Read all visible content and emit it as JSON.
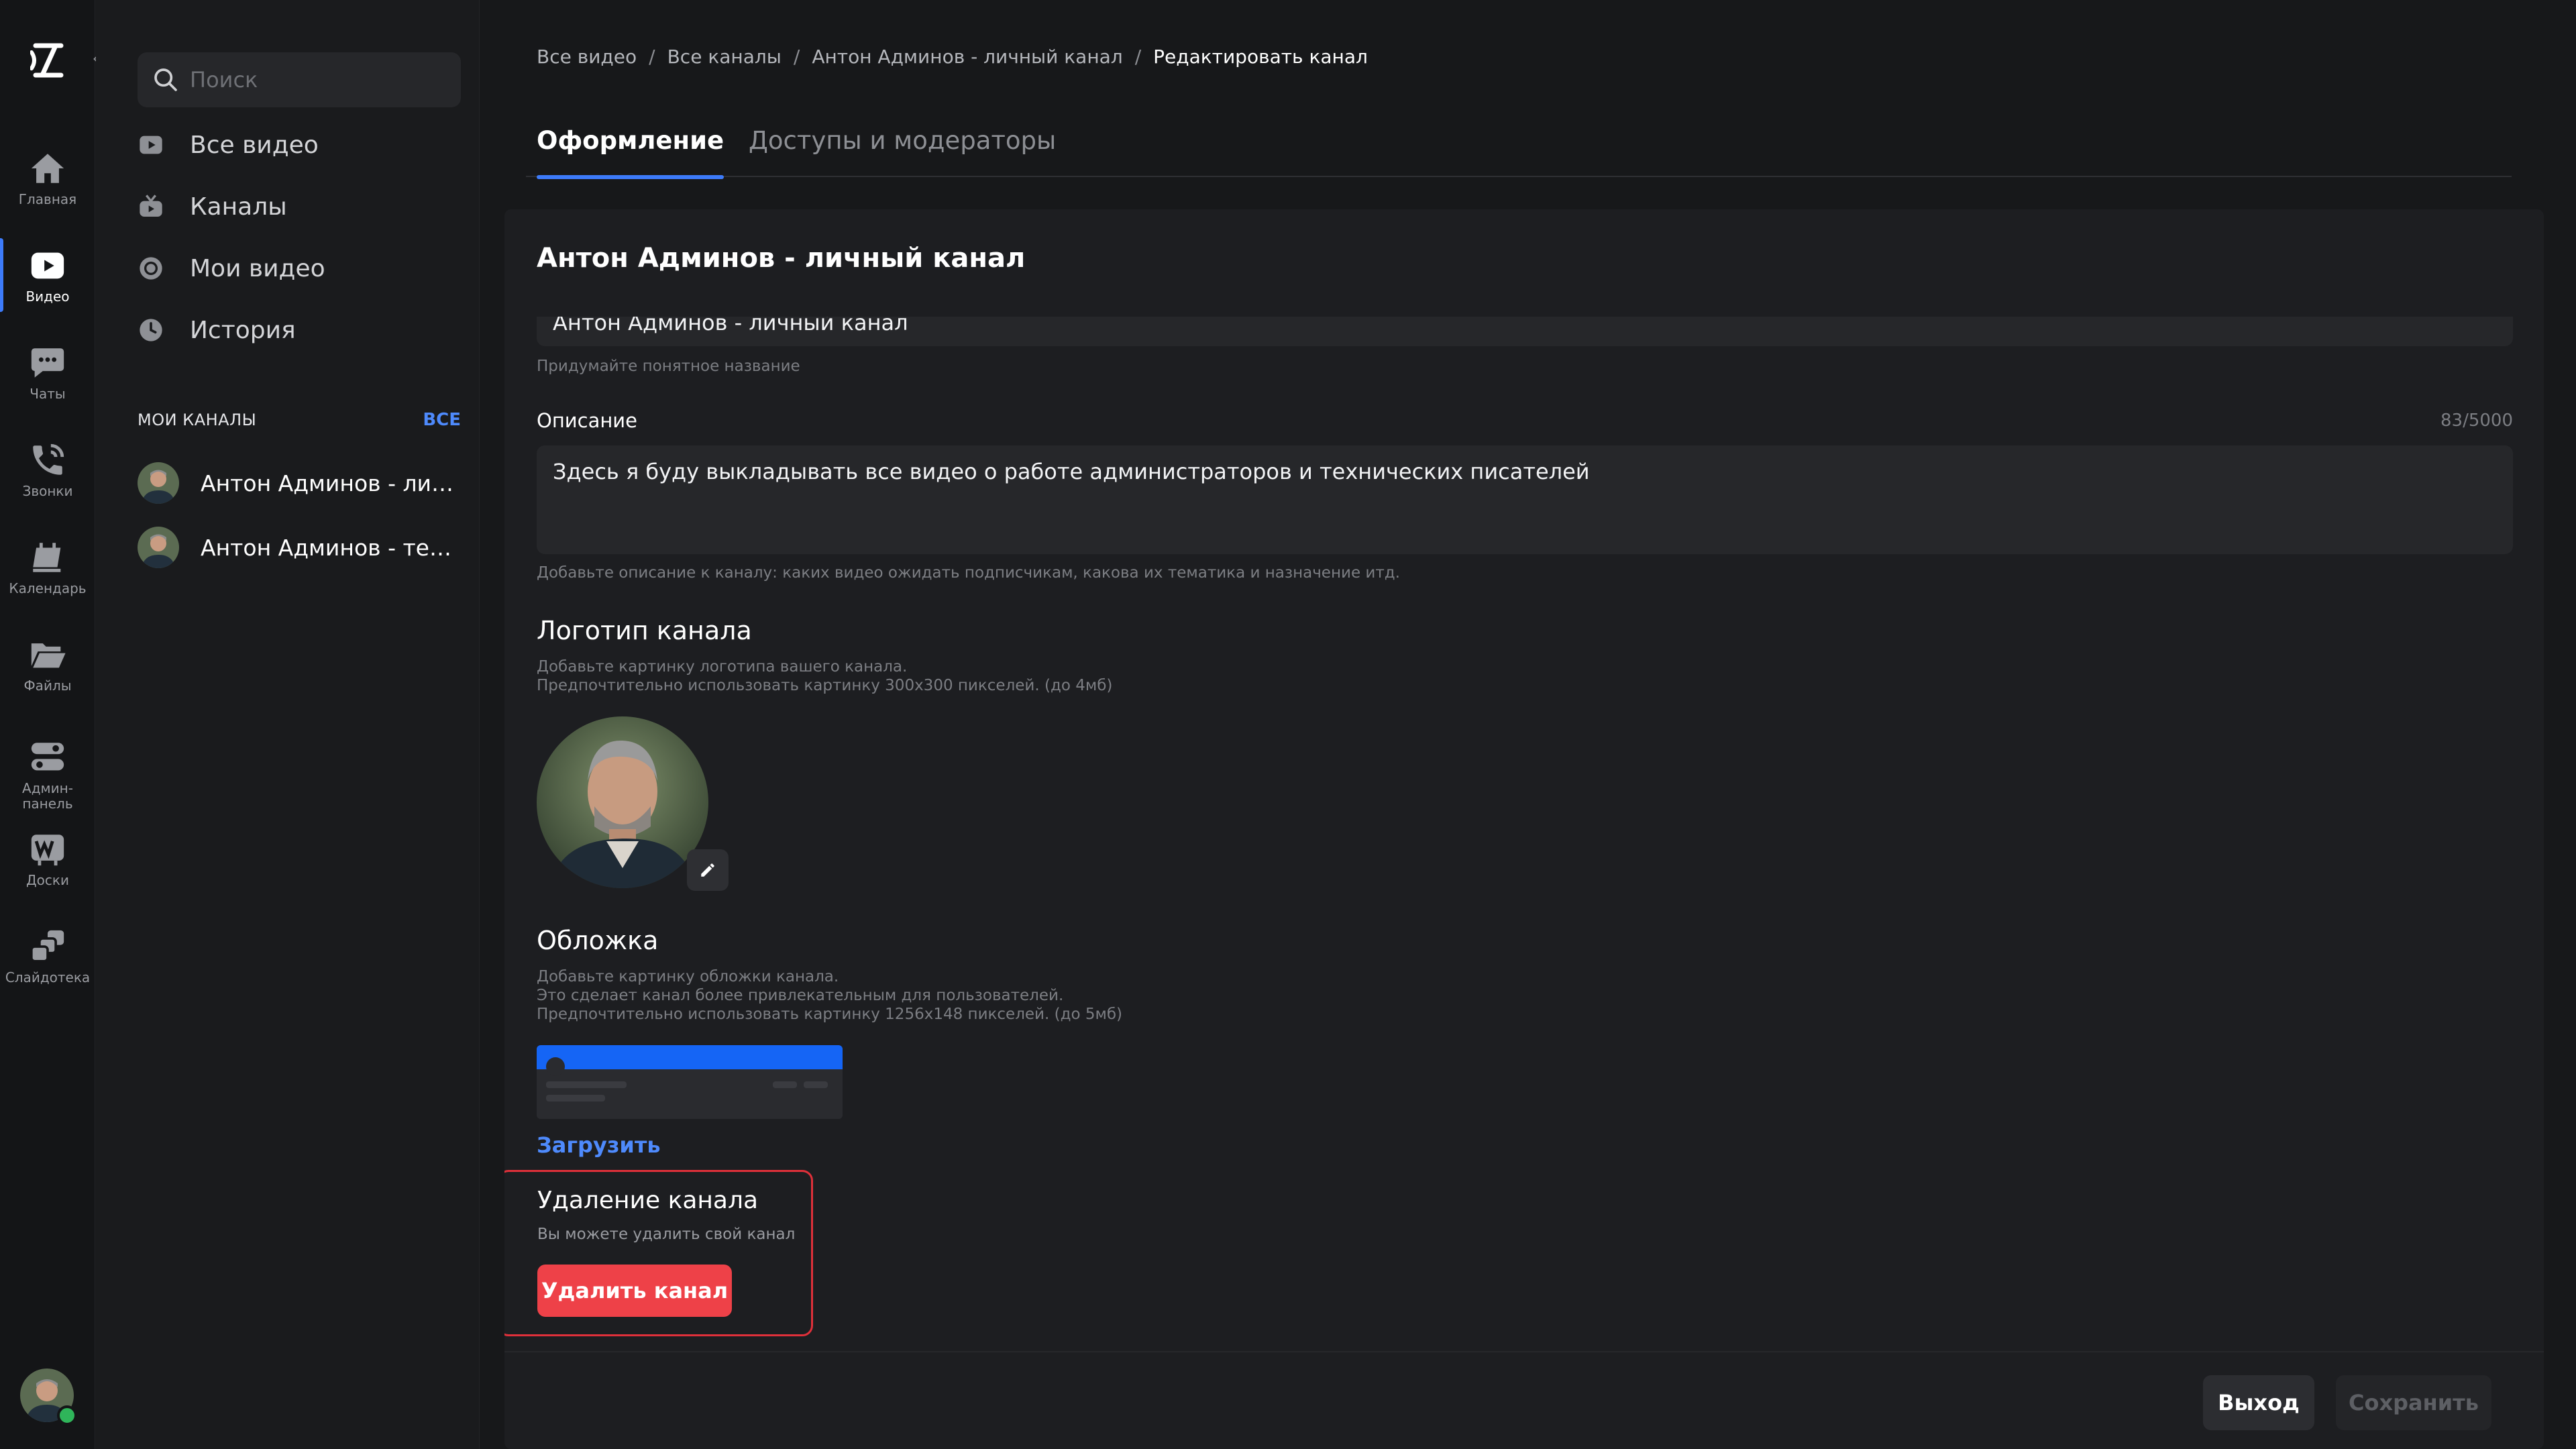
{
  "rail": {
    "items": [
      {
        "label": "Главная",
        "icon": "home-icon"
      },
      {
        "label": "Видео",
        "icon": "video-icon"
      },
      {
        "label": "Чаты",
        "icon": "chat-icon"
      },
      {
        "label": "Звонки",
        "icon": "phone-icon"
      },
      {
        "label": "Календарь",
        "icon": "calendar-icon"
      },
      {
        "label": "Файлы",
        "icon": "folder-icon"
      },
      {
        "label": "Админ-\nпанель",
        "icon": "admin-icon"
      },
      {
        "label": "Доски",
        "icon": "board-icon"
      },
      {
        "label": "Слайдотека",
        "icon": "slides-icon"
      }
    ],
    "active": "Видео"
  },
  "sidebar": {
    "search_placeholder": "Поиск",
    "nav": [
      {
        "label": "Все видео",
        "icon": "play-icon"
      },
      {
        "label": "Каналы",
        "icon": "tv-icon"
      },
      {
        "label": "Мои видео",
        "icon": "record-icon"
      },
      {
        "label": "История",
        "icon": "clock-icon"
      }
    ],
    "my_channels_title": "МОИ КАНАЛЫ",
    "all_link": "ВСЕ",
    "channels": [
      {
        "name": "Антон Админов - личн..."
      },
      {
        "name": "Антон Админов - тест..."
      }
    ]
  },
  "breadcrumbs": [
    "Все видео",
    "Все каналы",
    "Антон Админов - личный канал",
    "Редактировать канал"
  ],
  "tabs": [
    {
      "label": "Оформление",
      "active": true
    },
    {
      "label": "Доступы и модераторы",
      "active": false
    }
  ],
  "form": {
    "title": "Антон Админов - личный канал",
    "name_value": "Антон Админов - личный канал",
    "name_hint": "Придумайте понятное название",
    "description_label": "Описание",
    "description_counter": "83/5000",
    "description_value": "Здесь я буду выкладывать все видео о работе администраторов и технических писателей",
    "description_hint": "Добавьте описание к каналу: каких видео ожидать подписчикам, какова их тематика и назначение итд.",
    "logo_title": "Логотип канала",
    "logo_hint_1": "Добавьте картинку логотипа вашего канала.",
    "logo_hint_2": "Предпочтительно использовать картинку 300x300 пикселей. (до 4мб)",
    "cover_title": "Обложка",
    "cover_hint_1": "Добавьте картинку обложки канала.",
    "cover_hint_2": "Это сделает канал более привлекательным для пользователей.",
    "cover_hint_3": "Предпочтительно использовать картинку 1256x148 пикселей. (до 5мб)",
    "upload_label": "Загрузить",
    "delete_title": "Удаление канала",
    "delete_hint": "Вы можете удалить свой канал",
    "delete_button": "Удалить канал"
  },
  "footer": {
    "exit_label": "Выход",
    "save_label": "Сохранить"
  },
  "colors": {
    "accent": "#3d7bfa",
    "danger": "#ee4148",
    "online": "#2fb55a"
  }
}
